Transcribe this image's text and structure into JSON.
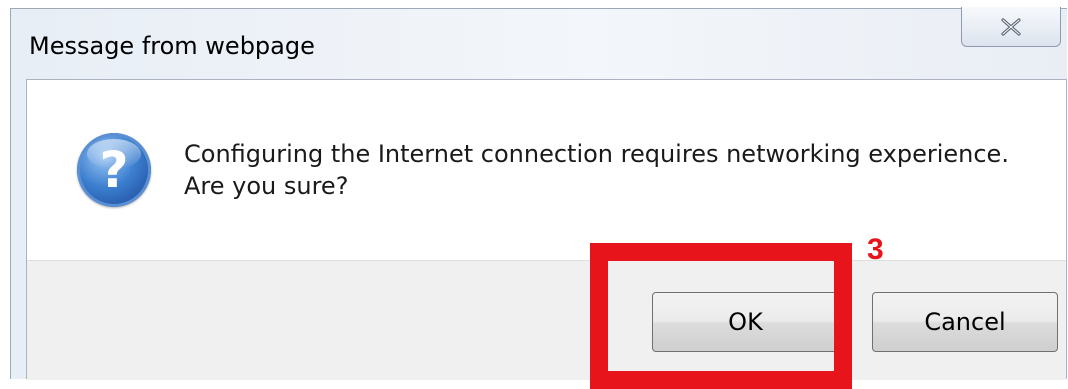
{
  "dialog": {
    "title": "Message from webpage",
    "close_icon": "close-icon",
    "question_icon": "question-icon",
    "question_glyph": "?",
    "message_line1": "Configuring the Internet connection requires networking experience.",
    "message_line2": "Are you sure?",
    "ok_label": "OK",
    "cancel_label": "Cancel"
  },
  "annotation": {
    "step_label": "3",
    "color": "#e8141c"
  }
}
